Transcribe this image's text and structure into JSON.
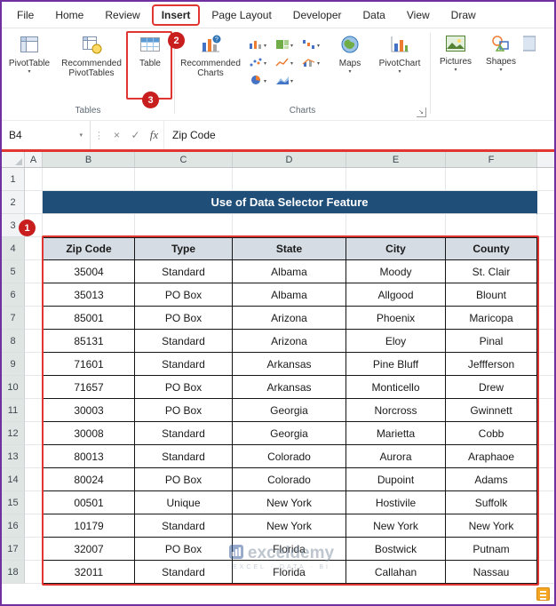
{
  "ribbon": {
    "tabs": [
      "File",
      "Home",
      "Review",
      "Insert",
      "Page Layout",
      "Developer",
      "Data",
      "View",
      "Draw"
    ],
    "groups": {
      "tables": {
        "label": "Tables",
        "pivottable": "PivotTable",
        "recommended_pivottables": "Recommended PivotTables",
        "table": "Table"
      },
      "charts": {
        "label": "Charts",
        "recommended_charts": "Recommended Charts",
        "maps": "Maps",
        "pivotchart": "PivotChart"
      },
      "illustrations": {
        "pictures": "Pictures",
        "shapes": "Shapes"
      }
    }
  },
  "formula_bar": {
    "name_box": "B4",
    "value": "Zip Code"
  },
  "icons": {
    "chevron": "▾",
    "cancel": "×",
    "enter": "✓",
    "fx": "fx",
    "divider": "⋮",
    "launcher": "↘"
  },
  "annotations": {
    "step1": "1",
    "step2": "2",
    "step3": "3"
  },
  "sheet": {
    "col_headers": [
      "A",
      "B",
      "C",
      "D",
      "E",
      "F"
    ],
    "rows": [
      {
        "n": "1",
        "type": "blank",
        "c": [
          "",
          "",
          "",
          "",
          ""
        ]
      },
      {
        "n": "2",
        "type": "title",
        "c": [
          "Use of Data Selector Feature",
          "",
          "",
          "",
          ""
        ]
      },
      {
        "n": "3",
        "type": "blank",
        "c": [
          "",
          "",
          "",
          "",
          ""
        ]
      },
      {
        "n": "4",
        "type": "header",
        "c": [
          "Zip Code",
          "Type",
          "State",
          "City",
          "County"
        ]
      },
      {
        "n": "5",
        "type": "data",
        "c": [
          "35004",
          "Standard",
          "Albama",
          "Moody",
          "St. Clair"
        ]
      },
      {
        "n": "6",
        "type": "data",
        "c": [
          "35013",
          "PO Box",
          "Albama",
          "Allgood",
          "Blount"
        ]
      },
      {
        "n": "7",
        "type": "data",
        "c": [
          "85001",
          "PO Box",
          "Arizona",
          "Phoenix",
          "Maricopa"
        ]
      },
      {
        "n": "8",
        "type": "data",
        "c": [
          "85131",
          "Standard",
          "Arizona",
          "Eloy",
          "Pinal"
        ]
      },
      {
        "n": "9",
        "type": "data",
        "c": [
          "71601",
          "Standard",
          "Arkansas",
          "Pine Bluff",
          "Jeffferson"
        ]
      },
      {
        "n": "10",
        "type": "data",
        "c": [
          "71657",
          "PO Box",
          "Arkansas",
          "Monticello",
          "Drew"
        ]
      },
      {
        "n": "11",
        "type": "data",
        "c": [
          "30003",
          "PO Box",
          "Georgia",
          "Norcross",
          "Gwinnett"
        ]
      },
      {
        "n": "12",
        "type": "data",
        "c": [
          "30008",
          "Standard",
          "Georgia",
          "Marietta",
          "Cobb"
        ]
      },
      {
        "n": "13",
        "type": "data",
        "c": [
          "80013",
          "Standard",
          "Colorado",
          "Aurora",
          "Araphaoe"
        ]
      },
      {
        "n": "14",
        "type": "data",
        "c": [
          "80024",
          "PO Box",
          "Colorado",
          "Dupoint",
          "Adams"
        ]
      },
      {
        "n": "15",
        "type": "data",
        "c": [
          "00501",
          "Unique",
          "New York",
          "Hostivile",
          "Suffolk"
        ]
      },
      {
        "n": "16",
        "type": "data",
        "c": [
          "10179",
          "Standard",
          "New York",
          "New York",
          "New York"
        ]
      },
      {
        "n": "17",
        "type": "data",
        "c": [
          "32007",
          "PO Box",
          "Florida",
          "Bostwick",
          "Putnam"
        ]
      },
      {
        "n": "18",
        "type": "data",
        "c": [
          "32011",
          "Standard",
          "Florida",
          "Callahan",
          "Nassau"
        ]
      }
    ]
  },
  "watermark": {
    "name": "exceldemy",
    "tagline": "EXCEL · DATA · BI"
  }
}
